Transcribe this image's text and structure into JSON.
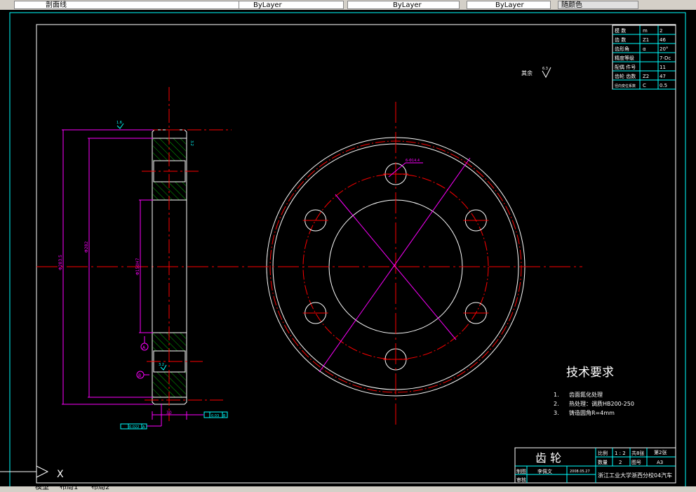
{
  "toolbar": {
    "layer": "剖面线",
    "color": "ByLayer",
    "linetype": "ByLayer",
    "lineweight": "ByLayer",
    "plotstyle": "随颜色"
  },
  "tabs": [
    "模型",
    "布局1",
    "布局2"
  ],
  "colors": {
    "background": "#000000",
    "frame": "#00ffff",
    "centerline": "#ff0000",
    "dimension": "#ff00ff",
    "hatch": "#00ff00",
    "outline": "#ffffff"
  },
  "params": [
    [
      "模 数",
      "m",
      "2"
    ],
    [
      "齿 数",
      "Z1",
      "46"
    ],
    [
      "齿形角",
      "α",
      "20°"
    ],
    [
      "精度等级",
      "",
      "7-Dc"
    ],
    [
      "配偶 件号",
      "",
      "11"
    ],
    [
      "齿轮 齿数",
      "Z2",
      "47"
    ],
    [
      "径向变位系数",
      "C",
      "0.5"
    ]
  ],
  "roughness_other": {
    "label": "其余",
    "value": "6.3"
  },
  "dims": {
    "outer": "Φ283.5",
    "root": "Φ282",
    "bore": "Φ150H7",
    "width": "30",
    "hole": "6-Φ14.4",
    "pcd": "Φ",
    "pcd2": "Φ",
    "ra_top": "1.6",
    "ra_side": "3.2",
    "ra_key": "3.2",
    "datum_a": "A",
    "datum_b": "B",
    "runout": "0.022",
    "runout_ref": "A",
    "parallel": "0.03",
    "parallel_ref": "B"
  },
  "tech": {
    "title": "技术要求",
    "items": [
      {
        "n": "1.",
        "t": "齿面氮化处理"
      },
      {
        "n": "2.",
        "t": "热处理：调质HB200-250"
      },
      {
        "n": "3.",
        "t": "铸造圆角R=4mm"
      }
    ]
  },
  "titleblock": {
    "name": "齿 轮",
    "scale_label": "比例",
    "scale": "1 : 2",
    "total_label": "共8张",
    "sheet_label": "第2张",
    "qty_label": "数量",
    "qty": "2",
    "drawno_label": "图号",
    "drawno": "A3",
    "drawn_label": "制图",
    "drawn_by": "李佩文",
    "date": "2008.05.27",
    "check_label": "审核",
    "school": "浙江工业大学浙西分校04汽车"
  },
  "ucs": {
    "x": "X"
  }
}
